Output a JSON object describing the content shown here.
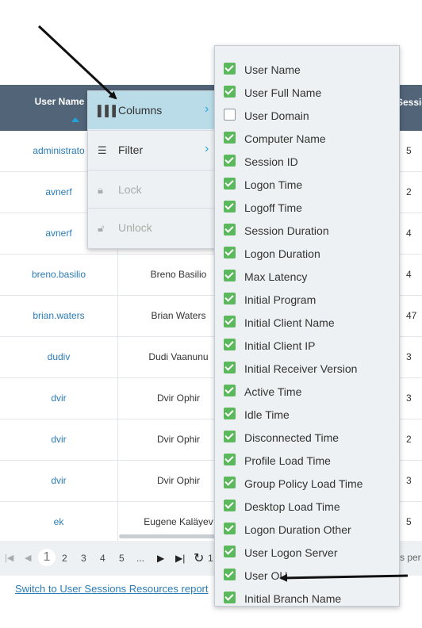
{
  "table": {
    "header": {
      "user_name": "User Name",
      "session_partial": "Sessio"
    },
    "rows": [
      {
        "user": "administrato",
        "full": "",
        "num": "5"
      },
      {
        "user": "avnerf",
        "full": "",
        "num": "2"
      },
      {
        "user": "avnerf",
        "full": "",
        "num": "4"
      },
      {
        "user": "breno.basilio",
        "full": "Breno Basilio",
        "num": "4"
      },
      {
        "user": "brian.waters",
        "full": "Brian Waters",
        "num": "47"
      },
      {
        "user": "dudiv",
        "full": "Dudi Vaanunu",
        "num": "3"
      },
      {
        "user": "dvir",
        "full": "Dvir Ophir",
        "num": "3"
      },
      {
        "user": "dvir",
        "full": "Dvir Ophir",
        "num": "2"
      },
      {
        "user": "dvir",
        "full": "Dvir Ophir",
        "num": "3"
      },
      {
        "user": "ek",
        "full": "Eugene Kaläyev",
        "num": "5"
      }
    ]
  },
  "pager": {
    "first_icon": "first-page-icon",
    "prev_icon": "prev-page-icon",
    "pages": [
      "1",
      "2",
      "3",
      "4",
      "5",
      "..."
    ],
    "next_icon": "next-page-icon",
    "last_icon": "last-page-icon",
    "refresh_icon": "refresh-icon",
    "refresh_suffix": "1",
    "items_per_page_partial": "s per"
  },
  "links": {
    "switch_report": "Switch to User Sessions Resources report"
  },
  "context_menu": {
    "columns": "Columns",
    "filter": "Filter",
    "lock": "Lock",
    "unlock": "Unlock"
  },
  "columns": [
    {
      "label": "User Name",
      "checked": true
    },
    {
      "label": "User Full Name",
      "checked": true
    },
    {
      "label": "User Domain",
      "checked": false
    },
    {
      "label": "Computer Name",
      "checked": true
    },
    {
      "label": "Session ID",
      "checked": true
    },
    {
      "label": "Logon Time",
      "checked": true
    },
    {
      "label": "Logoff Time",
      "checked": true
    },
    {
      "label": "Session Duration",
      "checked": true
    },
    {
      "label": "Logon Duration",
      "checked": true
    },
    {
      "label": "Max Latency",
      "checked": true
    },
    {
      "label": "Initial Program",
      "checked": true
    },
    {
      "label": "Initial Client Name",
      "checked": true
    },
    {
      "label": "Initial Client IP",
      "checked": true
    },
    {
      "label": "Initial Receiver Version",
      "checked": true
    },
    {
      "label": "Active Time",
      "checked": true
    },
    {
      "label": "Idle Time",
      "checked": true
    },
    {
      "label": "Disconnected Time",
      "checked": true
    },
    {
      "label": "Profile Load Time",
      "checked": true
    },
    {
      "label": "Group Policy Load Time",
      "checked": true
    },
    {
      "label": "Desktop Load Time",
      "checked": true
    },
    {
      "label": "Logon Duration Other",
      "checked": true
    },
    {
      "label": "User Logon Server",
      "checked": true
    },
    {
      "label": "User OU",
      "checked": true
    },
    {
      "label": "Initial Branch Name",
      "checked": true
    }
  ],
  "colors": {
    "header_bg": "#516478",
    "link": "#2a7cb8",
    "checkbox": "#5cb85c",
    "menu_highlight": "#b9dce8",
    "accent": "#2ea7dc"
  }
}
